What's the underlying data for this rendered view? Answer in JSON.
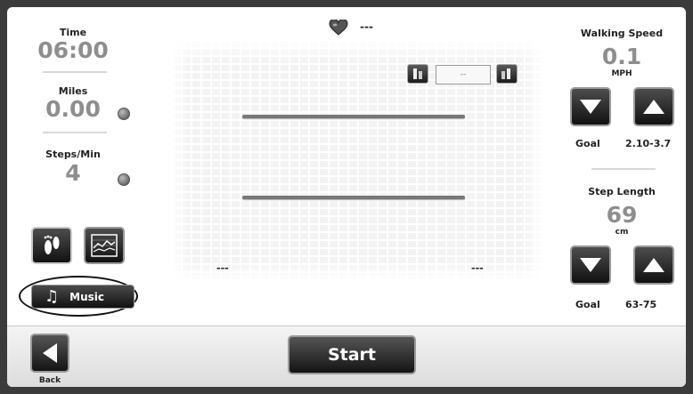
{
  "left_panel": {
    "time_label": "Time",
    "time_value": "06:00",
    "miles_label": "Miles",
    "miles_value": "0.00",
    "steps_label": "Steps/Min",
    "steps_value": "4",
    "music_label": "Music"
  },
  "center": {
    "heart_value": "---",
    "adjust_value": "--",
    "left_readout": "---",
    "right_readout": "---"
  },
  "right_panel": {
    "speed_label": "Walking Speed",
    "speed_value": "0.1",
    "speed_unit": "MPH",
    "speed_goal_label": "Goal",
    "speed_goal_value": "2.10-3.7",
    "step_label": "Step Length",
    "step_value": "69",
    "step_unit": "cm",
    "step_goal_label": "Goal",
    "step_goal_value": "63-75"
  },
  "bottom": {
    "start_label": "Start",
    "back_label": "Back"
  }
}
